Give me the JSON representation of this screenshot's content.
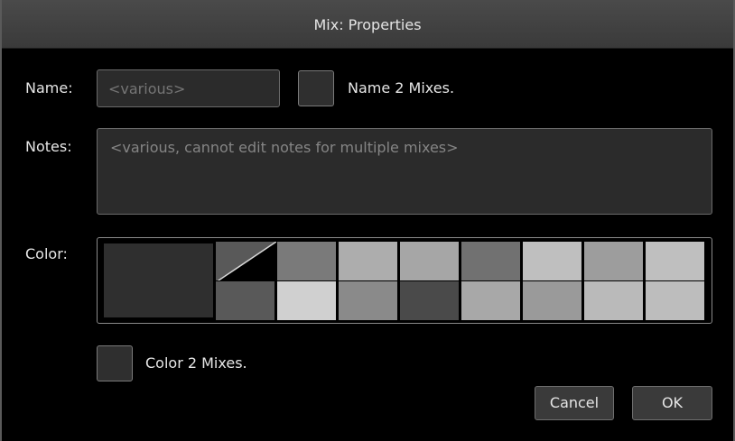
{
  "dialog": {
    "title": "Mix: Properties"
  },
  "name": {
    "label": "Name:",
    "placeholder": "<various>",
    "value": "",
    "checkbox_label": "Name 2 Mixes.",
    "checkbox_checked": false
  },
  "notes": {
    "label": "Notes:",
    "placeholder": "<various, cannot edit notes for multiple mixes>",
    "value": ""
  },
  "color": {
    "label": "Color:",
    "selected": "#2f2f2f",
    "top_row": [
      "none",
      "#7a7a7a",
      "#adadad",
      "#a6a6a6",
      "#717171",
      "#bfbfbf",
      "#9d9d9d",
      "#bfbfbf"
    ],
    "bottom_row": [
      "#595959",
      "#d0d0d0",
      "#8a8a8a",
      "#4a4a4a",
      "#a8a8a8",
      "#9a9a9a",
      "#bababa",
      "#bdbdbd"
    ],
    "checkbox_label": "Color 2 Mixes.",
    "checkbox_checked": false
  },
  "buttons": {
    "cancel": "Cancel",
    "ok": "OK"
  }
}
